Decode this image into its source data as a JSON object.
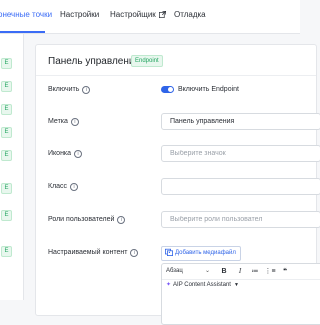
{
  "tabs": [
    {
      "label": "онечные точки",
      "active": true
    },
    {
      "label": "Настройки",
      "active": false
    },
    {
      "label": "Настройщик",
      "active": false,
      "icon": "external-link-icon"
    },
    {
      "label": "Отладка",
      "active": false
    }
  ],
  "sidebar": {
    "badges": [
      "E",
      "E",
      "E",
      "E",
      "E",
      "E",
      "E",
      "E"
    ]
  },
  "panel": {
    "title": "Панель управления",
    "badge": "Endpoint"
  },
  "form": {
    "enable_label": "Включить",
    "enable_toggle_label": "Включить Endpoint",
    "enable_on": true,
    "label_label": "Метка",
    "label_value": "Панель управления",
    "icon_label": "Иконка",
    "icon_placeholder": "Выберите значок",
    "class_label": "Класс",
    "class_value": "",
    "roles_label": "Роли пользователей",
    "roles_placeholder": "Выберите роли пользовател",
    "content_label": "Настраиваемый контент",
    "media_button": "Добавить медиафайл"
  },
  "editor": {
    "format_select": "Абзац",
    "toolbar": [
      "B",
      "I",
      "≔",
      "⋮≡",
      "❝"
    ],
    "aip_label": "AIP Content Assistant"
  },
  "colors": {
    "accent": "#3b6cf6",
    "green_badge": "#21a35f",
    "toggle": "#2f64e8"
  }
}
